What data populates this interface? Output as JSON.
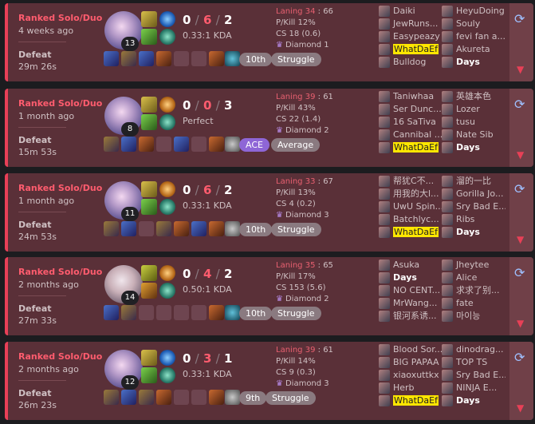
{
  "matches": [
    {
      "queue": "Ranked Solo/Duo",
      "ago": "4 weeks ago",
      "result": "Defeat",
      "duration": "29m 26s",
      "level": "13",
      "kills": "0",
      "deaths": "6",
      "assists": "2",
      "ratio": "0.33:1 KDA",
      "laning_label": "Laning",
      "laning_a": "34",
      "laning_b": "66",
      "pkill": "P/Kill 12%",
      "cs": "CS 18 (0.6)",
      "rank": "Diamond 1",
      "placement": "10th",
      "tag": "Struggle",
      "team_a": [
        "Daiki",
        "JewRuns...",
        "Easypeazy",
        "WhatDaEf",
        "Bulldog"
      ],
      "team_b": [
        "HeyuDoing",
        "Souly",
        "fevi fan a...",
        "Akureta",
        "Days"
      ]
    },
    {
      "queue": "Ranked Solo/Duo",
      "ago": "1 month ago",
      "result": "Defeat",
      "duration": "15m 53s",
      "level": "8",
      "kills": "0",
      "deaths": "0",
      "assists": "3",
      "ratio": "Perfect",
      "laning_label": "Laning",
      "laning_a": "39",
      "laning_b": "61",
      "pkill": "P/Kill 43%",
      "cs": "CS 22 (1.4)",
      "rank": "Diamond 2",
      "placement": "ACE",
      "tag": "Average",
      "team_a": [
        "Taniwhaa",
        "Ser Dunc...",
        "16 SaTiva",
        "Cannibal ...",
        "WhatDaEf"
      ],
      "team_b": [
        "英雄本色",
        "Lozer",
        "tusu",
        "Nate Sib",
        "Days"
      ]
    },
    {
      "queue": "Ranked Solo/Duo",
      "ago": "1 month ago",
      "result": "Defeat",
      "duration": "24m 53s",
      "level": "11",
      "kills": "0",
      "deaths": "6",
      "assists": "2",
      "ratio": "0.33:1 KDA",
      "laning_label": "Laning",
      "laning_a": "33",
      "laning_b": "67",
      "pkill": "P/Kill 13%",
      "cs": "CS 4 (0.2)",
      "rank": "Diamond 3",
      "placement": "10th",
      "tag": "Struggle",
      "team_a": [
        "帮犹C不...",
        "用我的大l...",
        "UwU Spin...",
        "Batchlyc...",
        "WhatDaEf"
      ],
      "team_b": [
        "溜的一比",
        "Gorilla Jo...",
        "Sry Bad E...",
        "Ribs",
        "Days"
      ]
    },
    {
      "queue": "Ranked Solo/Duo",
      "ago": "2 months ago",
      "result": "Defeat",
      "duration": "27m 33s",
      "level": "14",
      "kills": "0",
      "deaths": "4",
      "assists": "2",
      "ratio": "0.50:1 KDA",
      "laning_label": "Laning",
      "laning_a": "35",
      "laning_b": "65",
      "pkill": "P/Kill 17%",
      "cs": "CS 153 (5.6)",
      "rank": "Diamond 2",
      "placement": "10th",
      "tag": "Struggle",
      "team_a": [
        "Asuka",
        "Days",
        "NO CENT...",
        "MrWang...",
        "银河系诱..."
      ],
      "team_b": [
        "Jheytee",
        "Alice",
        "求求了别...",
        "fate",
        "마이능"
      ]
    },
    {
      "queue": "Ranked Solo/Duo",
      "ago": "2 months ago",
      "result": "Defeat",
      "duration": "26m 23s",
      "level": "12",
      "kills": "0",
      "deaths": "3",
      "assists": "1",
      "ratio": "0.33:1 KDA",
      "laning_label": "Laning",
      "laning_a": "39",
      "laning_b": "61",
      "pkill": "P/Kill 14%",
      "cs": "CS 9 (0.3)",
      "rank": "Diamond 3",
      "placement": "9th",
      "tag": "Struggle",
      "team_a": [
        "Blood Sor...",
        "BIG PAPAA",
        "xiaoxuttkx",
        "Herb",
        "WhatDaEf"
      ],
      "team_b": [
        "dinodrag...",
        "TOP TS",
        "Sry Bad E...",
        "NINJA E...",
        "Days"
      ]
    }
  ],
  "colors": {
    "defeat_accent": "#e84057",
    "ace": "#8e66d6",
    "highlight": "#ffe600"
  },
  "icons": {
    "swap": "swap-icon",
    "expand": "chevron-down-icon",
    "rank": "diamond-emblem-icon"
  }
}
